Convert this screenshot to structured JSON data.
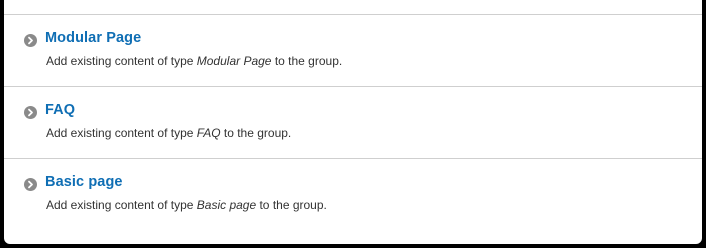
{
  "items": [
    {
      "title": "Modular Page",
      "desc_prefix": "Add existing content of type ",
      "desc_type": "Modular Page",
      "desc_suffix": " to the group."
    },
    {
      "title": "FAQ",
      "desc_prefix": "Add existing content of type ",
      "desc_type": "FAQ",
      "desc_suffix": " to the group."
    },
    {
      "title": "Basic page",
      "desc_prefix": "Add existing content of type ",
      "desc_type": "Basic page",
      "desc_suffix": " to the group."
    }
  ],
  "icons": {
    "item_icon": "chevron-right-circle-icon",
    "icon_color": "#8a8a8a"
  },
  "colors": {
    "link": "#0f6eb4",
    "text": "#333333",
    "divider": "#cfcfcf"
  }
}
